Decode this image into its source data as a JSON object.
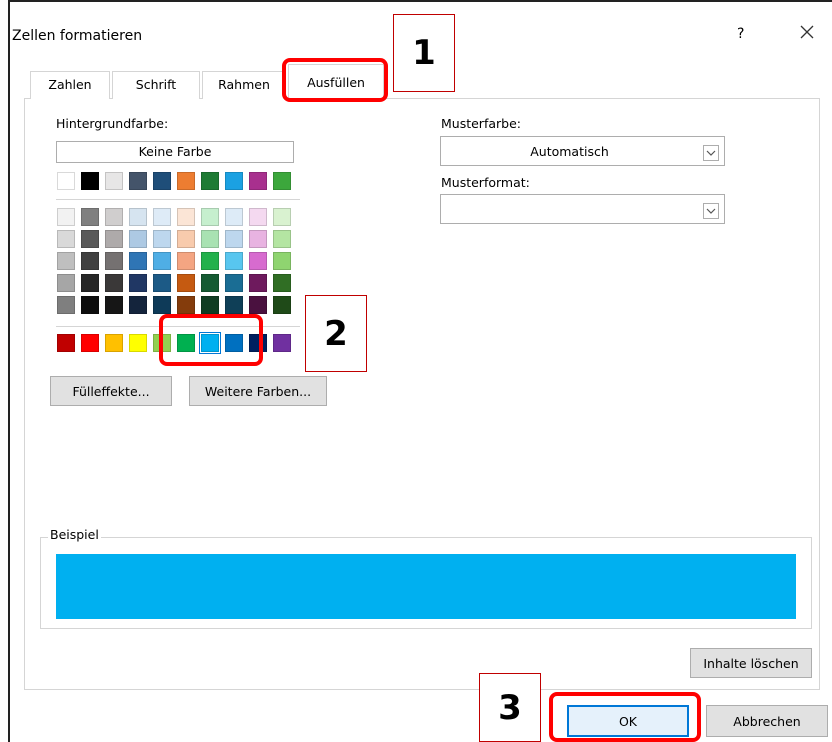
{
  "dialog": {
    "title": "Zellen formatieren",
    "help_label": "?",
    "close_icon": "close-icon"
  },
  "tabs": [
    {
      "label": "Zahlen",
      "active": false
    },
    {
      "label": "Schrift",
      "active": false
    },
    {
      "label": "Rahmen",
      "active": false
    },
    {
      "label": "Ausfüllen",
      "active": true
    }
  ],
  "fill": {
    "background_label": "Hintergrundfarbe:",
    "no_color_button": "Keine Farbe",
    "theme_top_row": [
      "#ffffff",
      "#000000",
      "#e7e6e6",
      "#44546a",
      "#1f4e79",
      "#ed7d31",
      "#1e7b34",
      "#1ba1e2",
      "#a8308e",
      "#3ca73c"
    ],
    "theme_rows": [
      [
        "#f2f2f2",
        "#808080",
        "#d0cece",
        "#d6e4f0",
        "#deebf7",
        "#fbe5d6",
        "#c6efce",
        "#ddebf7",
        "#f4d9f0",
        "#d9f2d0"
      ],
      [
        "#d9d9d9",
        "#595959",
        "#aeaaaa",
        "#adc9e3",
        "#bdd7ee",
        "#f8cbad",
        "#a9e2b2",
        "#bdd7ee",
        "#e8b3e1",
        "#b4e5a2"
      ],
      [
        "#bfbfbf",
        "#404040",
        "#757171",
        "#2f75b5",
        "#4faee5",
        "#f4a582",
        "#22b14c",
        "#58c6ef",
        "#d76bcf",
        "#8fd470"
      ],
      [
        "#a6a6a6",
        "#262626",
        "#3a3838",
        "#203764",
        "#1c5a86",
        "#c55a11",
        "#145a32",
        "#1a6d94",
        "#6e1a5d",
        "#306e24"
      ],
      [
        "#7f7f7f",
        "#0d0d0d",
        "#161616",
        "#14243c",
        "#0e3a58",
        "#843c0c",
        "#0f3c22",
        "#0f3f57",
        "#4a113f",
        "#1f4a18"
      ]
    ],
    "standard_row": [
      "#c00000",
      "#ff0000",
      "#ffc000",
      "#ffff00",
      "#92d050",
      "#00b050",
      "#00b0f0",
      "#0070c0",
      "#002060",
      "#7030a0"
    ],
    "fill_effects_button": "Fülleffekte...",
    "more_colors_button": "Weitere Farben...",
    "pattern_color_label": "Musterfarbe:",
    "pattern_color_value": "Automatisch",
    "pattern_format_label": "Musterformat:",
    "pattern_format_value": ""
  },
  "sample": {
    "label": "Beispiel",
    "color": "#00b0f0"
  },
  "buttons": {
    "clear": "Inhalte löschen",
    "ok": "OK",
    "cancel": "Abbrechen"
  },
  "annotations": [
    "1",
    "2",
    "3"
  ],
  "colors": {
    "annotation_red": "#ff0000",
    "border": "#adadad"
  }
}
